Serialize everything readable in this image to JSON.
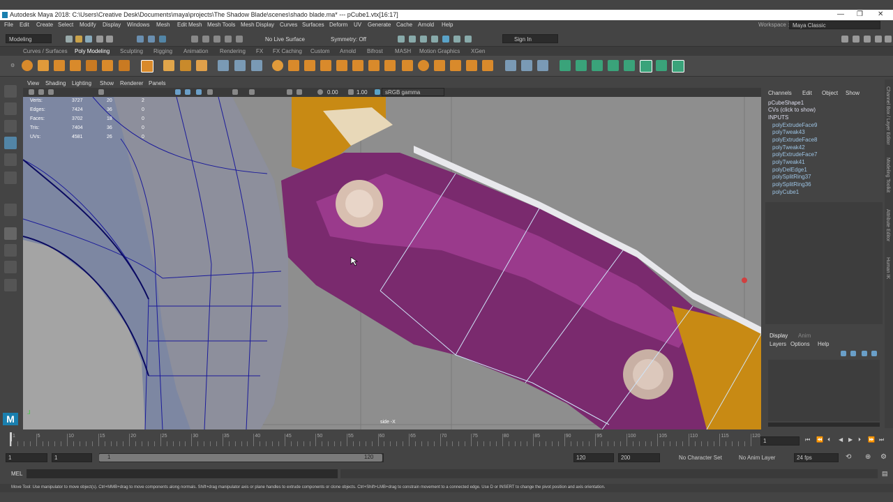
{
  "titlebar": {
    "title": "Autodesk Maya 2018: C:\\Users\\Creative Desk\\Documents\\maya\\projects\\The Shadow Blade\\scenes\\shado blade.ma*   ---   pCube1.vtx[16:17]",
    "minimize": "—",
    "maximize": "❐",
    "close": "✕"
  },
  "menubar": {
    "items": [
      "File",
      "Edit",
      "Create",
      "Select",
      "Modify",
      "Display",
      "Windows",
      "Mesh",
      "Edit Mesh",
      "Mesh Tools",
      "Mesh Display",
      "Curves",
      "Surfaces",
      "Deform",
      "UV",
      "Generate",
      "Cache",
      "Arnold",
      "Help"
    ],
    "workspace_label": "Workspace :",
    "workspace_value": "Maya Classic"
  },
  "statusline": {
    "mode": "Modeling",
    "live_surface": "No Live Surface",
    "symmetry": "Symmetry: Off",
    "sign_in": "Sign In"
  },
  "shelf_tabs": [
    "Curves / Surfaces",
    "Poly Modeling",
    "Sculpting",
    "Rigging",
    "Animation",
    "Rendering",
    "FX",
    "FX Caching",
    "Custom",
    "Arnold",
    "Bifrost",
    "MASH",
    "Motion Graphics",
    "XGen"
  ],
  "active_shelf_tab": "Poly Modeling",
  "viewport": {
    "menu": [
      "View",
      "Shading",
      "Lighting",
      "Show",
      "Renderer",
      "Panels"
    ],
    "exposure": "0.00",
    "gamma": "1.00",
    "color_space": "sRGB gamma",
    "camera_label": "side -X",
    "hud": [
      {
        "label": "Verts:",
        "v1": "3727",
        "v2": "20",
        "v3": "2"
      },
      {
        "label": "Edges:",
        "v1": "7424",
        "v2": "36",
        "v3": "0"
      },
      {
        "label": "Faces:",
        "v1": "3702",
        "v2": "18",
        "v3": "0"
      },
      {
        "label": "Tris:",
        "v1": "7404",
        "v2": "36",
        "v3": "0"
      },
      {
        "label": "UVs:",
        "v1": "4581",
        "v2": "26",
        "v3": "0"
      }
    ]
  },
  "channel_box": {
    "menu": [
      "Channels",
      "Edit",
      "Object",
      "Show"
    ],
    "shape": "pCubeShape1",
    "cvs": "CVs (click to show)",
    "inputs_label": "INPUTS",
    "inputs": [
      "polyExtrudeFace9",
      "polyTweak43",
      "polyExtrudeFace8",
      "polyTweak42",
      "polyExtrudeFace7",
      "polyTweak41",
      "polyDelEdge1",
      "polySplitRing37",
      "polySplitRing36",
      "polyCube1"
    ]
  },
  "layer_editor": {
    "tabs": [
      "Display",
      "Anim"
    ],
    "menu": [
      "Layers",
      "Options",
      "Help"
    ]
  },
  "side_tabs": [
    "Channel Box / Layer Editor",
    "Modeling Toolkit",
    "Attribute Editor",
    "Human IK"
  ],
  "time_slider": {
    "ticks": [
      "1",
      "5",
      "10",
      "15",
      "20",
      "25",
      "30",
      "35",
      "40",
      "45",
      "50",
      "55",
      "60",
      "65",
      "70",
      "75",
      "80",
      "85",
      "90",
      "95",
      "100",
      "105",
      "110",
      "115",
      "120"
    ],
    "current_frame": "1"
  },
  "range_slider": {
    "start": "1",
    "playback_start": "1",
    "handle_start": "1",
    "handle_end": "120",
    "playback_end": "120",
    "end": "200",
    "character_set": "No Character Set",
    "anim_layer": "No Anim Layer",
    "fps": "24 fps"
  },
  "cmdline": {
    "label": "MEL"
  },
  "helpline": {
    "text": "Move Tool: Use manipulator to move object(s). Ctrl+MMB+drag to move components along normals. Shift+drag manipulator axis or plane handles to extrude components or clone objects. Ctrl+Shift+LMB+drag to constrain movement to a connected edge. Use D or INSERT to change the pivot position and axis orientation."
  },
  "colors": {
    "accent": "#5285a6",
    "purple": "#7a2a6e",
    "gold": "#c88a14",
    "wire": "#1a1a9a"
  }
}
